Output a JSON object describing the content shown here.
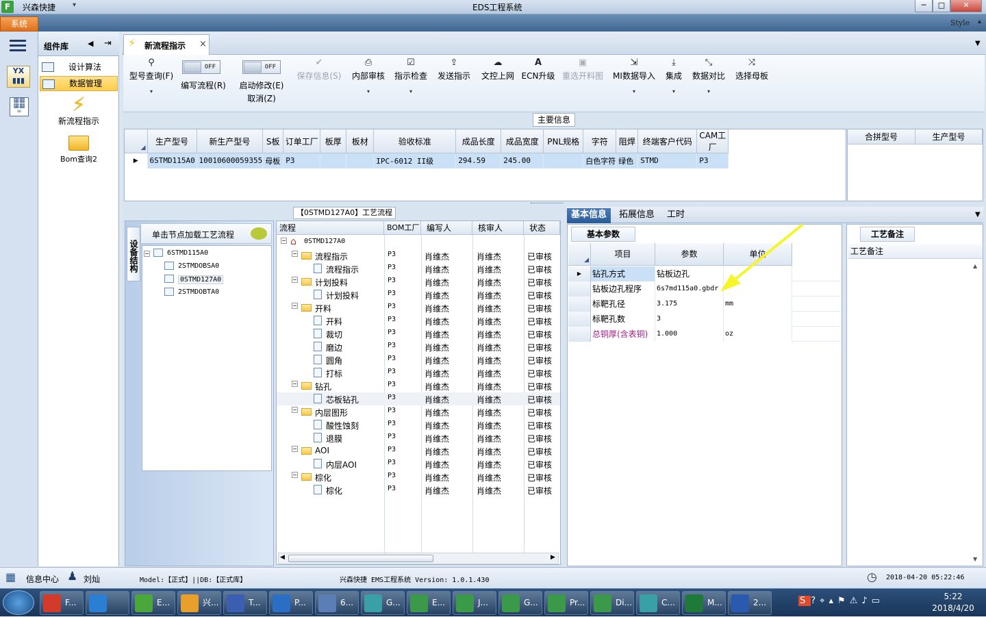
{
  "window": {
    "app_icon_label": "F",
    "app_name": "兴森快捷",
    "title": "EDS工程系统",
    "style_label": "Style",
    "controls": {
      "minimize": "─",
      "maximize": "□",
      "close": "✕"
    }
  },
  "menu": {
    "system": "系统"
  },
  "palette": {
    "title": "组件库",
    "items": [
      {
        "label": "设计算法"
      },
      {
        "label": "数据管理"
      }
    ],
    "launchers": [
      {
        "label": "新流程指示"
      },
      {
        "label": "Bom查询2"
      }
    ]
  },
  "tab": {
    "label": "新流程指示",
    "close": "×"
  },
  "toolbar": {
    "items": [
      {
        "label": "型号查询(F)",
        "icon": "search-icon"
      },
      {
        "label": "编写流程(R)",
        "toggle": "OFF"
      },
      {
        "label": "启动修改(E)",
        "sub": "取消(Z)",
        "toggle": "OFF"
      },
      {
        "label": "保存信息(S)",
        "icon": "check-icon"
      },
      {
        "label": "内部审核",
        "icon": "print-icon"
      },
      {
        "label": "指示检查",
        "icon": "checkbox-icon"
      },
      {
        "label": "发送指示",
        "icon": "upload-icon"
      },
      {
        "label": "文控上网",
        "icon": "cloud-upload-icon"
      },
      {
        "label": "ECN升级",
        "icon": "font-a-icon"
      },
      {
        "label": "重选开料图",
        "icon": "image-icon"
      },
      {
        "label": "MI数据导入",
        "icon": "import-icon"
      },
      {
        "label": "集成",
        "icon": "download-icon"
      },
      {
        "label": "数据对比",
        "icon": "compare-icon"
      },
      {
        "label": "选择母板",
        "icon": "shuffle-icon"
      }
    ]
  },
  "main_info": {
    "label": "主要信息",
    "columns": [
      "生产型号",
      "新生产型号",
      "S板",
      "订单工厂",
      "板厚",
      "板材",
      "验收标准",
      "成品长度",
      "成品宽度",
      "PNL规格",
      "字符",
      "阻焊",
      "终端客户代码",
      "CAM工厂"
    ],
    "rows": [
      [
        "6STMD115A0",
        "10010600059355",
        "母板",
        "P3",
        "",
        "",
        "IPC-6012 II级",
        "294.59",
        "245.00",
        "",
        "白色字符",
        "绿色",
        "STMD",
        "P3"
      ]
    ],
    "side_columns": [
      "合拼型号",
      "生产型号"
    ]
  },
  "flow_panel": {
    "label": "【0STMD127A0】工艺流程",
    "device_tab": "设备结构",
    "device_header": "单击节点加载工艺流程",
    "device_tree": [
      {
        "label": "6STMD115A0",
        "level": 0
      },
      {
        "label": "2STMDOBSA0",
        "level": 1
      },
      {
        "label": "0STMD127A0",
        "level": 1
      },
      {
        "label": "2STMDOBTA0",
        "level": 1
      }
    ],
    "columns": [
      "流程",
      "BOM工厂",
      "编写人",
      "核审人",
      "状态"
    ],
    "rows": [
      {
        "name": "0STMD127A0",
        "level": 0,
        "type": "root",
        "factory": "",
        "writer": "",
        "reviewer": "",
        "status": ""
      },
      {
        "name": "流程指示",
        "level": 1,
        "type": "folder",
        "factory": "P3",
        "writer": "肖维杰",
        "reviewer": "肖维杰",
        "status": "已审核"
      },
      {
        "name": "流程指示",
        "level": 2,
        "type": "file",
        "factory": "P3",
        "writer": "肖维杰",
        "reviewer": "肖维杰",
        "status": "已审核"
      },
      {
        "name": "计划投料",
        "level": 1,
        "type": "folder",
        "factory": "P3",
        "writer": "肖维杰",
        "reviewer": "肖维杰",
        "status": "已审核"
      },
      {
        "name": "计划投料",
        "level": 2,
        "type": "file",
        "factory": "P3",
        "writer": "肖维杰",
        "reviewer": "肖维杰",
        "status": "已审核"
      },
      {
        "name": "开料",
        "level": 1,
        "type": "folder",
        "factory": "P3",
        "writer": "肖维杰",
        "reviewer": "肖维杰",
        "status": "已审核"
      },
      {
        "name": "开料",
        "level": 2,
        "type": "file",
        "factory": "P3",
        "writer": "肖维杰",
        "reviewer": "肖维杰",
        "status": "已审核"
      },
      {
        "name": "裁切",
        "level": 2,
        "type": "file",
        "factory": "P3",
        "writer": "肖维杰",
        "reviewer": "肖维杰",
        "status": "已审核"
      },
      {
        "name": "磨边",
        "level": 2,
        "type": "file",
        "factory": "P3",
        "writer": "肖维杰",
        "reviewer": "肖维杰",
        "status": "已审核"
      },
      {
        "name": "圆角",
        "level": 2,
        "type": "file",
        "factory": "P3",
        "writer": "肖维杰",
        "reviewer": "肖维杰",
        "status": "已审核"
      },
      {
        "name": "打标",
        "level": 2,
        "type": "file",
        "factory": "P3",
        "writer": "肖维杰",
        "reviewer": "肖维杰",
        "status": "已审核"
      },
      {
        "name": "钻孔",
        "level": 1,
        "type": "folder",
        "factory": "P3",
        "writer": "肖维杰",
        "reviewer": "肖维杰",
        "status": "已审核"
      },
      {
        "name": "芯板钻孔",
        "level": 2,
        "type": "file",
        "factory": "P3",
        "writer": "肖维杰",
        "reviewer": "肖维杰",
        "status": "已审核",
        "selected": true
      },
      {
        "name": "内层图形",
        "level": 1,
        "type": "folder",
        "factory": "P3",
        "writer": "肖维杰",
        "reviewer": "肖维杰",
        "status": "已审核"
      },
      {
        "name": "酸性蚀刻",
        "level": 2,
        "type": "file",
        "factory": "P3",
        "writer": "肖维杰",
        "reviewer": "肖维杰",
        "status": "已审核"
      },
      {
        "name": "退膜",
        "level": 2,
        "type": "file",
        "factory": "P3",
        "writer": "肖维杰",
        "reviewer": "肖维杰",
        "status": "已审核"
      },
      {
        "name": "AOI",
        "level": 1,
        "type": "folder",
        "factory": "P3",
        "writer": "肖维杰",
        "reviewer": "肖维杰",
        "status": "已审核"
      },
      {
        "name": "内层AOI",
        "level": 2,
        "type": "file",
        "factory": "P3",
        "writer": "肖维杰",
        "reviewer": "肖维杰",
        "status": "已审核"
      },
      {
        "name": "棕化",
        "level": 1,
        "type": "folder",
        "factory": "P3",
        "writer": "肖维杰",
        "reviewer": "肖维杰",
        "status": "已审核"
      },
      {
        "name": "棕化",
        "level": 2,
        "type": "file",
        "factory": "P3",
        "writer": "肖维杰",
        "reviewer": "肖维杰",
        "status": "已审核"
      }
    ]
  },
  "basic_tabs": [
    "基本信息",
    "拓展信息",
    "工时"
  ],
  "params": {
    "title": "基本参数",
    "columns": [
      "项目",
      "参数",
      "单位"
    ],
    "rows": [
      {
        "item": "钻孔方式",
        "value": "钻板边孔",
        "unit": "",
        "highlight": false
      },
      {
        "item": "钻板边孔程序",
        "value": "6s7md115a0.gbdr",
        "unit": "",
        "highlight": false
      },
      {
        "item": "标靶孔径",
        "value": "3.175",
        "unit": "mm",
        "highlight": false
      },
      {
        "item": "标靶孔数",
        "value": "3",
        "unit": "",
        "highlight": false
      },
      {
        "item": "总铜厚(含表铜)",
        "value": "1.000",
        "unit": "oz",
        "highlight": true
      }
    ]
  },
  "remarks": {
    "title": "工艺备注",
    "header": "工艺备注"
  },
  "status": {
    "info_center": "信息中心",
    "user": "刘灿",
    "model": "Model:【正式】||DB:【正式库】",
    "version": "兴森快捷 EMS工程系统 Version: 1.0.1.430",
    "datetime": "2018-04-20 05:22:46"
  },
  "taskbar": {
    "items": [
      {
        "label": "F...",
        "color": "#d43a2a"
      },
      {
        "label": "",
        "color": "#2a7fd4"
      },
      {
        "label": "E...",
        "color": "#4aa83a"
      },
      {
        "label": "兴...",
        "color": "#e8a02a"
      },
      {
        "label": "T...",
        "color": "#3a5fb0"
      },
      {
        "label": "P...",
        "color": "#2a6fc4"
      },
      {
        "label": "6...",
        "color": "#5a7fb5"
      },
      {
        "label": "G...",
        "color": "#3aa0a8"
      },
      {
        "label": "E...",
        "color": "#3a9a4a"
      },
      {
        "label": "J...",
        "color": "#3a9a4a"
      },
      {
        "label": "G...",
        "color": "#3a9a4a"
      },
      {
        "label": "Pr...",
        "color": "#3a9a4a"
      },
      {
        "label": "Di...",
        "color": "#3a9a4a"
      },
      {
        "label": "C...",
        "color": "#3aa0a8"
      },
      {
        "label": "M...",
        "color": "#1f7a3a"
      },
      {
        "label": "2...",
        "color": "#2a5ab0"
      }
    ],
    "clock_time": "5:22",
    "clock_date": "2018/4/20"
  }
}
